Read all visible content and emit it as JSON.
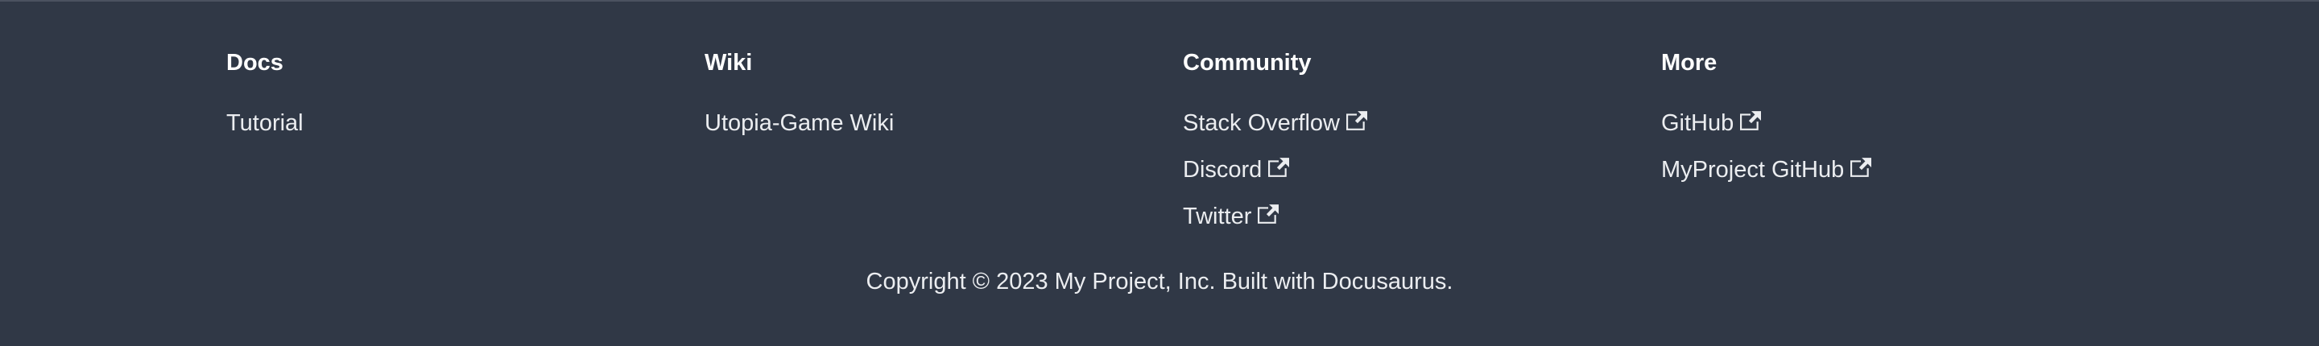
{
  "columns": [
    {
      "title": "Docs",
      "links": [
        {
          "label": "Tutorial",
          "external": false
        }
      ]
    },
    {
      "title": "Wiki",
      "links": [
        {
          "label": "Utopia-Game Wiki",
          "external": false
        }
      ]
    },
    {
      "title": "Community",
      "links": [
        {
          "label": "Stack Overflow",
          "external": true
        },
        {
          "label": "Discord",
          "external": true
        },
        {
          "label": "Twitter",
          "external": true
        }
      ]
    },
    {
      "title": "More",
      "links": [
        {
          "label": "GitHub",
          "external": true
        },
        {
          "label": "MyProject GitHub",
          "external": true
        }
      ]
    }
  ],
  "copyright": "Copyright © 2023 My Project, Inc. Built with Docusaurus.",
  "icons": {
    "external": "external-link-icon"
  },
  "colors": {
    "background": "#303846",
    "title": "#ffffff",
    "link": "#ebedf0"
  }
}
